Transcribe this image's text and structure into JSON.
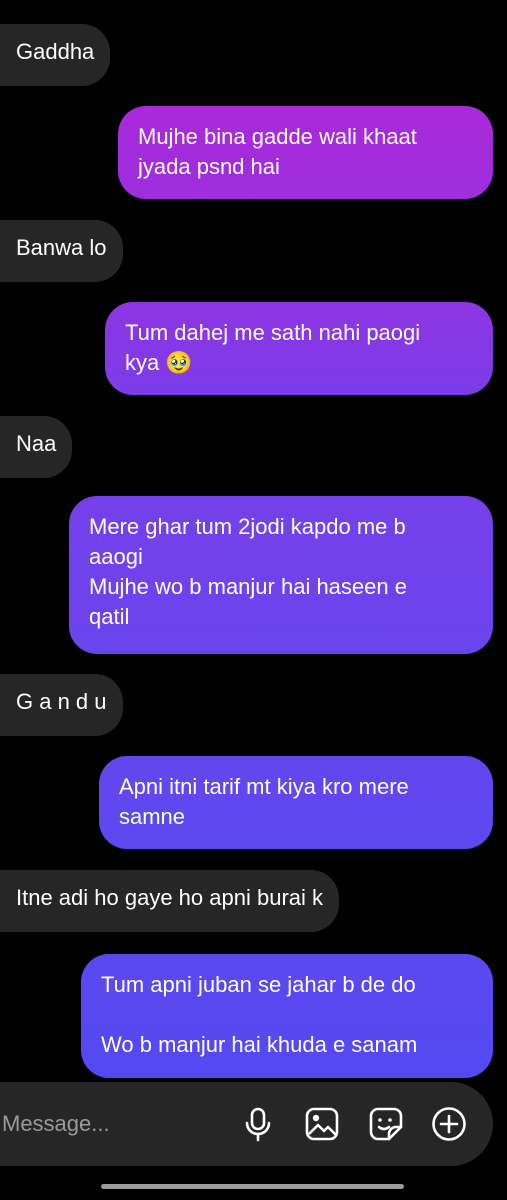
{
  "messages": [
    {
      "side": "received",
      "text": "Gaddha"
    },
    {
      "side": "sent",
      "text": "Mujhe bina gadde wali khaat\njyada psnd hai"
    },
    {
      "side": "received",
      "text": "Banwa lo"
    },
    {
      "side": "sent",
      "text": "Tum dahej me sath nahi paogi\nkya 🥹"
    },
    {
      "side": "received",
      "text": "Naa"
    },
    {
      "side": "sent",
      "text": "Mere ghar tum 2jodi kapdo me b\naaogi\nMujhe wo b manjur hai haseen e\nqatil"
    },
    {
      "side": "received",
      "text": "G a n d u"
    },
    {
      "side": "sent",
      "text": "Apni itni tarif mt kiya kro mere\nsamne"
    },
    {
      "side": "received",
      "text": "Itne adi ho gaye ho apni burai k"
    },
    {
      "side": "sent",
      "text": "Tum apni juban se jahar b de do\n\nWo b manjur hai khuda e sanam"
    }
  ],
  "composer": {
    "placeholder": "Message..."
  },
  "icons": {
    "mic": "microphone-icon",
    "gallery": "gallery-icon",
    "sticker": "sticker-icon",
    "add": "plus-circle-icon"
  },
  "colors": {
    "background": "#000000",
    "received_bubble": "#262626",
    "sent_gradient_top": "#a72bdc",
    "sent_gradient_bottom": "#5848f0"
  }
}
